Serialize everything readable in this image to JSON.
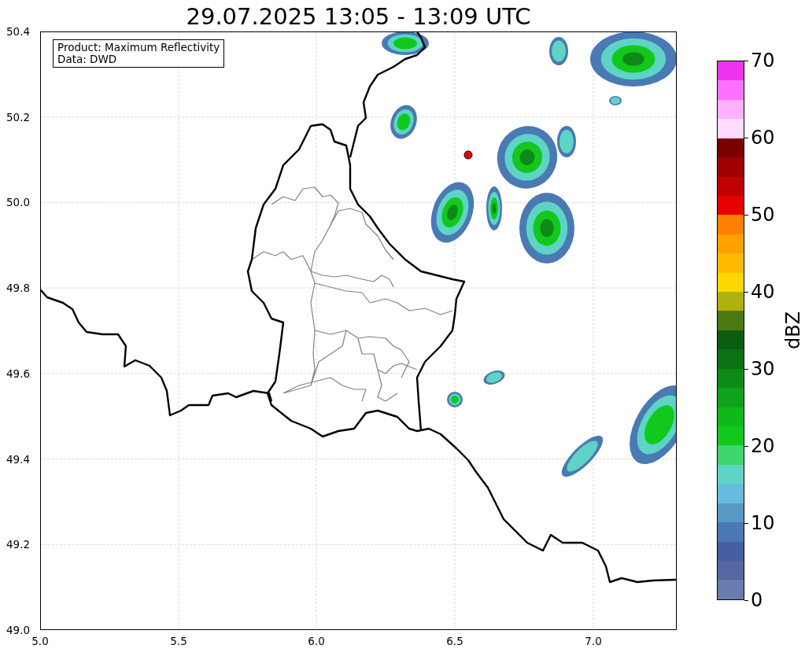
{
  "title": "29.07.2025 13:05 - 13:09 UTC",
  "legend": [
    "Product: Maximum Reflectivity",
    "Data: DWD"
  ],
  "x_ticks": [
    "5.0",
    "5.5",
    "6.0",
    "6.5",
    "7.0"
  ],
  "y_ticks": [
    "50.4",
    "50.2",
    "50.0",
    "49.8",
    "49.6",
    "49.4",
    "49.2",
    "49.0"
  ],
  "colorbar": {
    "label": "dBZ",
    "ticks": [
      "70",
      "60",
      "50",
      "40",
      "30",
      "20",
      "10",
      "0"
    ],
    "segments": [
      {
        "color": "#ee33ee"
      },
      {
        "color": "#ff70ff"
      },
      {
        "color": "#ffb0ff"
      },
      {
        "color": "#ffdcff"
      },
      {
        "color": "#7a0000"
      },
      {
        "color": "#a00000"
      },
      {
        "color": "#c10000"
      },
      {
        "color": "#e60000"
      },
      {
        "color": "#ff7f00"
      },
      {
        "color": "#ff9f00"
      },
      {
        "color": "#ffbb00"
      },
      {
        "color": "#ffd700"
      },
      {
        "color": "#b0b10c"
      },
      {
        "color": "#4b7a0f"
      },
      {
        "color": "#0b5c10"
      },
      {
        "color": "#0b7112"
      },
      {
        "color": "#0e8a16"
      },
      {
        "color": "#0fa21a"
      },
      {
        "color": "#10b81a"
      },
      {
        "color": "#12c81d"
      },
      {
        "color": "#3ed46e"
      },
      {
        "color": "#5dd4c6"
      },
      {
        "color": "#66bcdc"
      },
      {
        "color": "#5798c5"
      },
      {
        "color": "#4a79b3"
      },
      {
        "color": "#4460a3"
      },
      {
        "color": "#5566a0"
      },
      {
        "color": "#6a7bad"
      }
    ]
  }
}
